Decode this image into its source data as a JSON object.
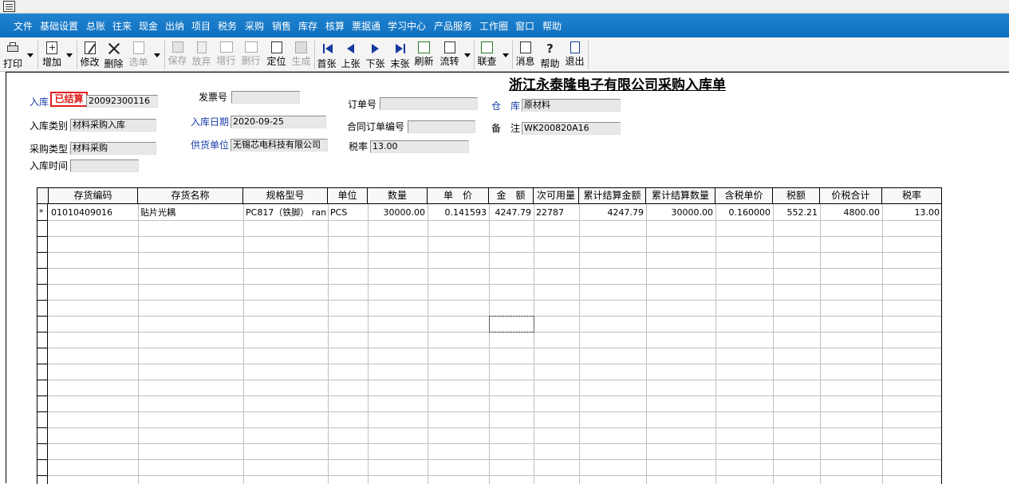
{
  "menu": [
    "文件",
    "基础设置",
    "总账",
    "往来",
    "现金",
    "出纳",
    "项目",
    "税务",
    "采购",
    "销售",
    "库存",
    "核算",
    "票据通",
    "学习中心",
    "产品服务",
    "工作圈",
    "窗口",
    "帮助"
  ],
  "toolbar": {
    "print": "打印",
    "add": "增加",
    "edit": "修改",
    "delete": "删除",
    "select": "选单",
    "save": "保存",
    "discard": "放弃",
    "add_row": "增行",
    "del_row": "删行",
    "locate": "定位",
    "generate": "生成",
    "first": "首张",
    "prev": "上张",
    "next": "下张",
    "last": "末张",
    "refresh": "刷新",
    "flow": "流转",
    "query": "联查",
    "message": "消息",
    "help": "帮助",
    "exit": "退出"
  },
  "form": {
    "title": "浙江永泰隆电子有限公司采购入库单",
    "stamp": "已结算",
    "in_no_label": "入库",
    "in_no": "20092300116",
    "invoice_label": "发票号",
    "invoice": "",
    "order_label": "订单号",
    "order": "",
    "warehouse_label": "仓　库",
    "warehouse": "原材料",
    "in_type_label": "入库类别",
    "in_type": "材料采购入库",
    "in_date_label": "入库日期",
    "in_date": "2020-09-25",
    "contract_label": "合同订单编号",
    "contract": "",
    "remark_label": "备　注",
    "remark": "WK200820A16",
    "purchase_type_label": "采购类型",
    "purchase_type": "材料采购",
    "supplier_label": "供货单位",
    "supplier": "无锡芯电科技有限公司",
    "tax_rate_label": "税率",
    "tax_rate": "13.00",
    "in_time_label": "入库时间",
    "in_time": ""
  },
  "grid": {
    "columns": [
      "存货编码",
      "存货名称",
      "规格型号",
      "单位",
      "数量",
      "单　价",
      "金　额",
      "次可用量",
      "累计结算金额",
      "累计结算数量",
      "含税单价",
      "税额",
      "价税合计",
      "税率"
    ],
    "rows": [
      {
        "marker": "*",
        "code": "01010409016",
        "name": "贴片光耦",
        "spec": "PC817（铁脚） ran",
        "unit": "PCS",
        "qty": "30000.00",
        "price": "0.141593",
        "amount": "4247.79",
        "avail": "22787",
        "settled_amount": "4247.79",
        "settled_qty": "30000.00",
        "tax_price": "0.160000",
        "tax": "552.21",
        "total": "4800.00",
        "rate": "13.00"
      }
    ]
  }
}
